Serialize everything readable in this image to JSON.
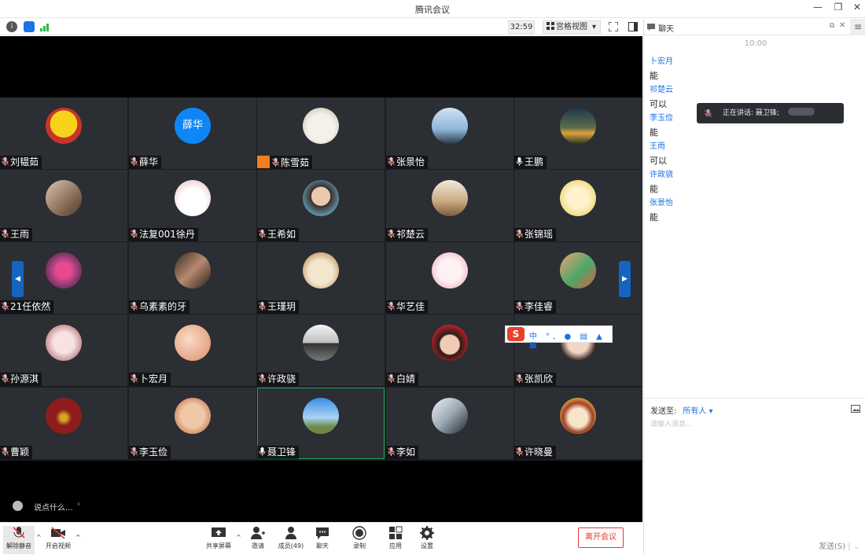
{
  "window": {
    "title": "腾讯会议"
  },
  "infobar": {
    "timer": "32:59",
    "view_mode": "宫格视图"
  },
  "grid": {
    "tiles": [
      {
        "name": "刘韫茹",
        "av": "pikachu"
      },
      {
        "name": "薛华",
        "av": "text",
        "avatar_text": "薛华"
      },
      {
        "name": "陈雪茹",
        "av": "dog",
        "host": true
      },
      {
        "name": "张景怡",
        "av": "lake"
      },
      {
        "name": "王鹏",
        "av": "sunset",
        "mic_on": true
      },
      {
        "name": "王雨",
        "av": "forest"
      },
      {
        "name": "法复001徐丹",
        "av": "bunny"
      },
      {
        "name": "王希如",
        "av": "girl"
      },
      {
        "name": "祁楚云",
        "av": "cat"
      },
      {
        "name": "张锦瑶",
        "av": "anime"
      },
      {
        "name": "21任依然",
        "av": "pink"
      },
      {
        "name": "乌素素的牙",
        "av": "people"
      },
      {
        "name": "王瑾玥",
        "av": "puppy"
      },
      {
        "name": "华艺佳",
        "av": "drawn"
      },
      {
        "name": "李佳睿",
        "av": "cartoon"
      },
      {
        "name": "孙源淇",
        "av": "animefem"
      },
      {
        "name": "卜宏月",
        "av": "peach"
      },
      {
        "name": "许政骁",
        "av": "person"
      },
      {
        "name": "白婧",
        "av": "bow"
      },
      {
        "name": "张凯欣",
        "av": "face"
      },
      {
        "name": "曹颖",
        "av": "red"
      },
      {
        "name": "李玉俭",
        "av": "baby"
      },
      {
        "name": "聂卫锋",
        "av": "sky",
        "active": true,
        "mic_on": true
      },
      {
        "name": "李如",
        "av": "bw"
      },
      {
        "name": "许晓曼",
        "av": "chibi"
      }
    ]
  },
  "chat_bar": {
    "placeholder": "说点什么..."
  },
  "toolbar": {
    "unmute": "解除静音",
    "video": "开启视频",
    "share": "共享屏幕",
    "invite": "邀请",
    "members": "成员(49)",
    "chat": "聊天",
    "record": "录制",
    "apps": "应用",
    "settings": "设置",
    "leave": "离开会议"
  },
  "chat": {
    "title": "聊天",
    "time": "10:00",
    "messages": [
      {
        "sender": "卜宏月",
        "text": "能"
      },
      {
        "sender": "祁楚云",
        "text": "可以"
      },
      {
        "sender": "李玉俭",
        "text": "能"
      },
      {
        "sender": "王雨",
        "text": "可以"
      },
      {
        "sender": "许政骁",
        "text": "能"
      },
      {
        "sender": "张景怡",
        "text": "能"
      }
    ],
    "speaking": "正在讲话: 聂卫锋;",
    "send_to_label": "发送至:",
    "send_to_value": "所有人",
    "input_placeholder": "请输入消息...",
    "send_button": "发送(S)"
  },
  "colors": {
    "accent": "#0f86f5",
    "leave": "#e53935",
    "active_border": "#1aaf5d",
    "tile_bg": "#2b2e33"
  }
}
